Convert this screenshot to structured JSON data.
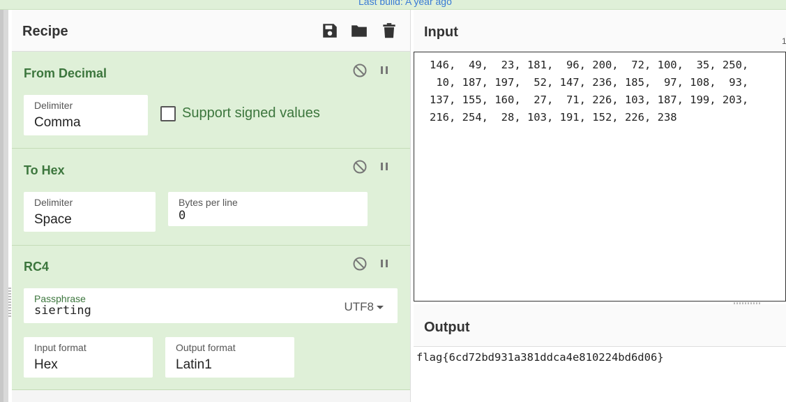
{
  "topbar": {
    "text": "Last build: A year ago"
  },
  "recipe": {
    "title": "Recipe",
    "operations": [
      {
        "name": "From Decimal",
        "delimiter_label": "Delimiter",
        "delimiter_value": "Comma",
        "checkbox_label": "Support signed values",
        "checkbox_checked": false
      },
      {
        "name": "To Hex",
        "delimiter_label": "Delimiter",
        "delimiter_value": "Space",
        "bytes_label": "Bytes per line",
        "bytes_value": "0"
      },
      {
        "name": "RC4",
        "passphrase_label": "Passphrase",
        "passphrase_value": "sierting",
        "passphrase_encoding": "UTF8",
        "input_format_label": "Input format",
        "input_format_value": "Hex",
        "output_format_label": "Output format",
        "output_format_value": "Latin1"
      }
    ]
  },
  "input": {
    "title": "Input",
    "corner_text": "1",
    "lines": [
      "146,  49,  23, 181,  96, 200,  72, 100,  35, 250,",
      " 10, 187, 197,  52, 147, 236, 185,  97, 108,  93,",
      "137, 155, 160,  27,  71, 226, 103, 187, 199, 203,",
      "216, 254,  28, 103, 191, 152, 226, 238"
    ]
  },
  "output": {
    "title": "Output",
    "text": "flag{6cd72bd931a381ddca4e810224bd6d06}"
  },
  "icons": {
    "save": "save-icon",
    "open": "folder-icon",
    "clear": "trash-icon",
    "disable": "disable-icon",
    "pause": "pause-icon"
  },
  "colors": {
    "operation_bg": "#dff0d8",
    "operation_title": "#3c763d",
    "link": "#3a7bd5"
  }
}
